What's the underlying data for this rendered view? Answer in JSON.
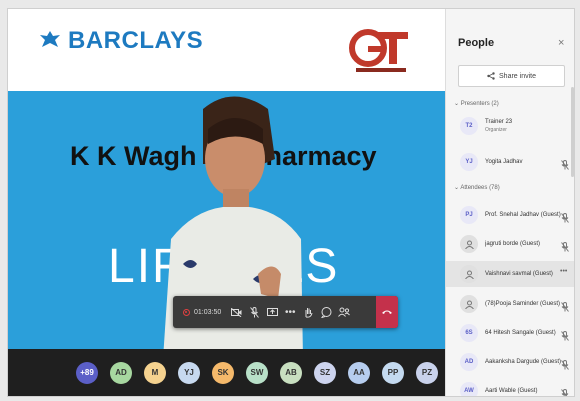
{
  "slide": {
    "brand": "BARCLAYS",
    "title": "K K Wagh C        f Pharmacy",
    "subtitle": "LIFE    ILLS"
  },
  "toolbar": {
    "timer": "01:03:50",
    "icons": [
      "camera-off-icon",
      "mic-off-icon",
      "share-screen-icon",
      "more-icon",
      "raise-hand-icon",
      "chat-icon",
      "participants-icon",
      "hang-up-icon"
    ]
  },
  "participants_bar": [
    {
      "initials": "+89",
      "color": "#5b5fc7",
      "text": "#ffffff"
    },
    {
      "initials": "AD",
      "color": "#a7d7a0"
    },
    {
      "initials": "M",
      "color": "#f5d28f"
    },
    {
      "initials": "YJ",
      "color": "#c7d9ef"
    },
    {
      "initials": "SK",
      "color": "#f5b96b"
    },
    {
      "initials": "SW",
      "color": "#b8e0c8"
    },
    {
      "initials": "AB",
      "color": "#c8dfc0"
    },
    {
      "initials": "SZ",
      "color": "#cdd4ee"
    },
    {
      "initials": "AA",
      "color": "#b6cdee"
    },
    {
      "initials": "PP",
      "color": "#c4daf0"
    },
    {
      "initials": "PZ",
      "color": "#c9d2ec"
    }
  ],
  "panel": {
    "title": "People",
    "close": "×",
    "share_invite": "Share invite",
    "presenters_label": "Presenters (2)",
    "attendees_label": "Attendees (78)",
    "presenters": [
      {
        "initials": "T2",
        "name": "Trainer 23",
        "role": "Organizer"
      },
      {
        "initials": "YJ",
        "name": "Yogita Jadhav"
      }
    ],
    "attendees": [
      {
        "initials": "PJ",
        "name": "Prof. Snehal Jadhav (Guest)"
      },
      {
        "initials": "",
        "name": "jagruti borde (Guest)"
      },
      {
        "initials": "",
        "name": "Vaishnavi savmal (Guest)"
      },
      {
        "initials": "",
        "name": "(78)Pooja Saminder (Guest)"
      },
      {
        "initials": "6S",
        "name": "64 Hitesh Sangale (Guest)"
      },
      {
        "initials": "AD",
        "name": "Aakanksha Dargude (Guest)"
      },
      {
        "initials": "AW",
        "name": "Aarti Wable (Guest)"
      }
    ]
  }
}
